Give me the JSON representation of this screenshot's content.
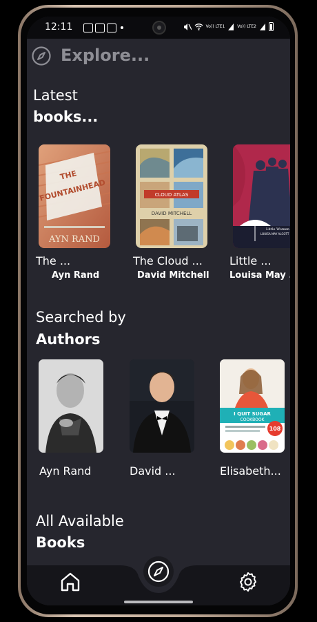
{
  "status_bar": {
    "time": "12:11",
    "left_icons": [
      "image-icon",
      "chat-icon",
      "box-icon"
    ],
    "network_top": "Vo)) LTE1",
    "network_bottom": "Vo)) LTE2"
  },
  "header": {
    "title": "Explore..."
  },
  "latest": {
    "line1": "Latest",
    "line2": "books...",
    "books": [
      {
        "title": "The ...",
        "author": "Ayn Rand",
        "cover_colors": [
          "#c26a4b",
          "#e9b18a"
        ],
        "cover_text": "THE FOUNTAINHEAD",
        "cover_author": "AYN RAND"
      },
      {
        "title": "The Cloud ...",
        "author": "David Mitchell",
        "cover_colors": [
          "#d9c9a5",
          "#7fa2b8"
        ],
        "cover_text": "CLOUD ATLAS",
        "cover_author": "DAVID MITCHELL"
      },
      {
        "title": "Little ...",
        "author": "Louisa May ...",
        "cover_colors": [
          "#b1274a",
          "#2b2f4c"
        ],
        "cover_text": "Little Women",
        "cover_author": "LOUISA MAY ALCOTT"
      }
    ]
  },
  "authors": {
    "line1": "Searched by",
    "line2": "Authors",
    "items": [
      {
        "name": "Ayn Rand"
      },
      {
        "name": "David ..."
      },
      {
        "name": "Elisabeth..."
      }
    ],
    "cookbook_title": "I QUIT SUGAR COOKBOOK",
    "cookbook_badge": "108"
  },
  "all_books": {
    "line1": "All Available",
    "line2": "Books"
  },
  "nav": {
    "home_label": "home-icon",
    "explore_label": "compass-icon",
    "settings_label": "gear-icon"
  },
  "colors": {
    "background": "#26262e",
    "nav_background": "#15151a",
    "text": "#ffffff",
    "muted": "#8e8e95"
  }
}
